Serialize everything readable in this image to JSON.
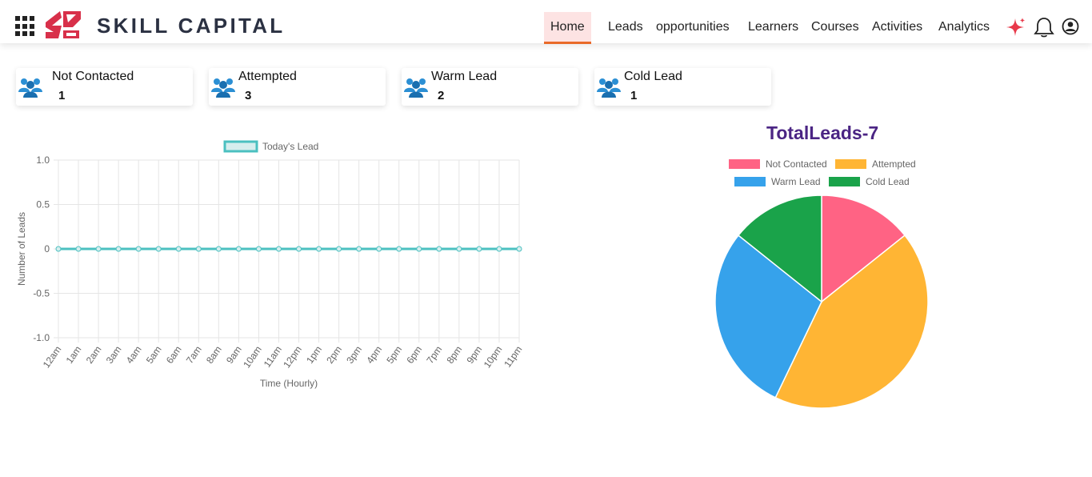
{
  "brand": {
    "name": "SKILL CAPITAL",
    "logo_color": "#d8304a"
  },
  "nav": {
    "items": [
      {
        "label": "Home",
        "active": true
      },
      {
        "label": "Leads"
      },
      {
        "label": "opportunities"
      },
      {
        "label": "Learners"
      },
      {
        "label": "Courses"
      },
      {
        "label": "Activities"
      },
      {
        "label": "Analytics"
      }
    ],
    "icons": [
      "sparkle-icon",
      "bell-icon",
      "user-profile-icon"
    ]
  },
  "cards": [
    {
      "title": "Not Contacted",
      "count": "1"
    },
    {
      "title": "Attempted",
      "count": "3"
    },
    {
      "title": "Warm Lead",
      "count": "2"
    },
    {
      "title": "Cold Lead",
      "count": "1"
    }
  ],
  "chart_data": [
    {
      "type": "line",
      "legend": [
        "Today's Lead"
      ],
      "legend_position": "top",
      "xlabel": "Time (Hourly)",
      "ylabel": "Number of Leads",
      "x": [
        "12am",
        "1am",
        "2am",
        "3am",
        "4am",
        "5am",
        "6am",
        "7am",
        "8am",
        "9am",
        "10am",
        "11am",
        "12pm",
        "1pm",
        "2pm",
        "3pm",
        "4pm",
        "5pm",
        "6pm",
        "7pm",
        "8pm",
        "9pm",
        "10pm",
        "11pm"
      ],
      "series": [
        {
          "name": "Today's Lead",
          "values": [
            0,
            0,
            0,
            0,
            0,
            0,
            0,
            0,
            0,
            0,
            0,
            0,
            0,
            0,
            0,
            0,
            0,
            0,
            0,
            0,
            0,
            0,
            0,
            0
          ],
          "color": "#4bc0c0"
        }
      ],
      "ylim": [
        -1.0,
        1.0
      ],
      "yticks": [
        "1.0",
        "0.5",
        "0",
        "-0.5",
        "-1.0"
      ],
      "grid": true
    },
    {
      "type": "pie",
      "title": "TotalLeads-7",
      "legend_position": "top",
      "categories": [
        "Not Contacted",
        "Attempted",
        "Warm Lead",
        "Cold Lead"
      ],
      "values": [
        1,
        3,
        2,
        1
      ],
      "colors": [
        "#ff6384",
        "#ffb534",
        "#36a2eb",
        "#1aa34a"
      ]
    }
  ]
}
